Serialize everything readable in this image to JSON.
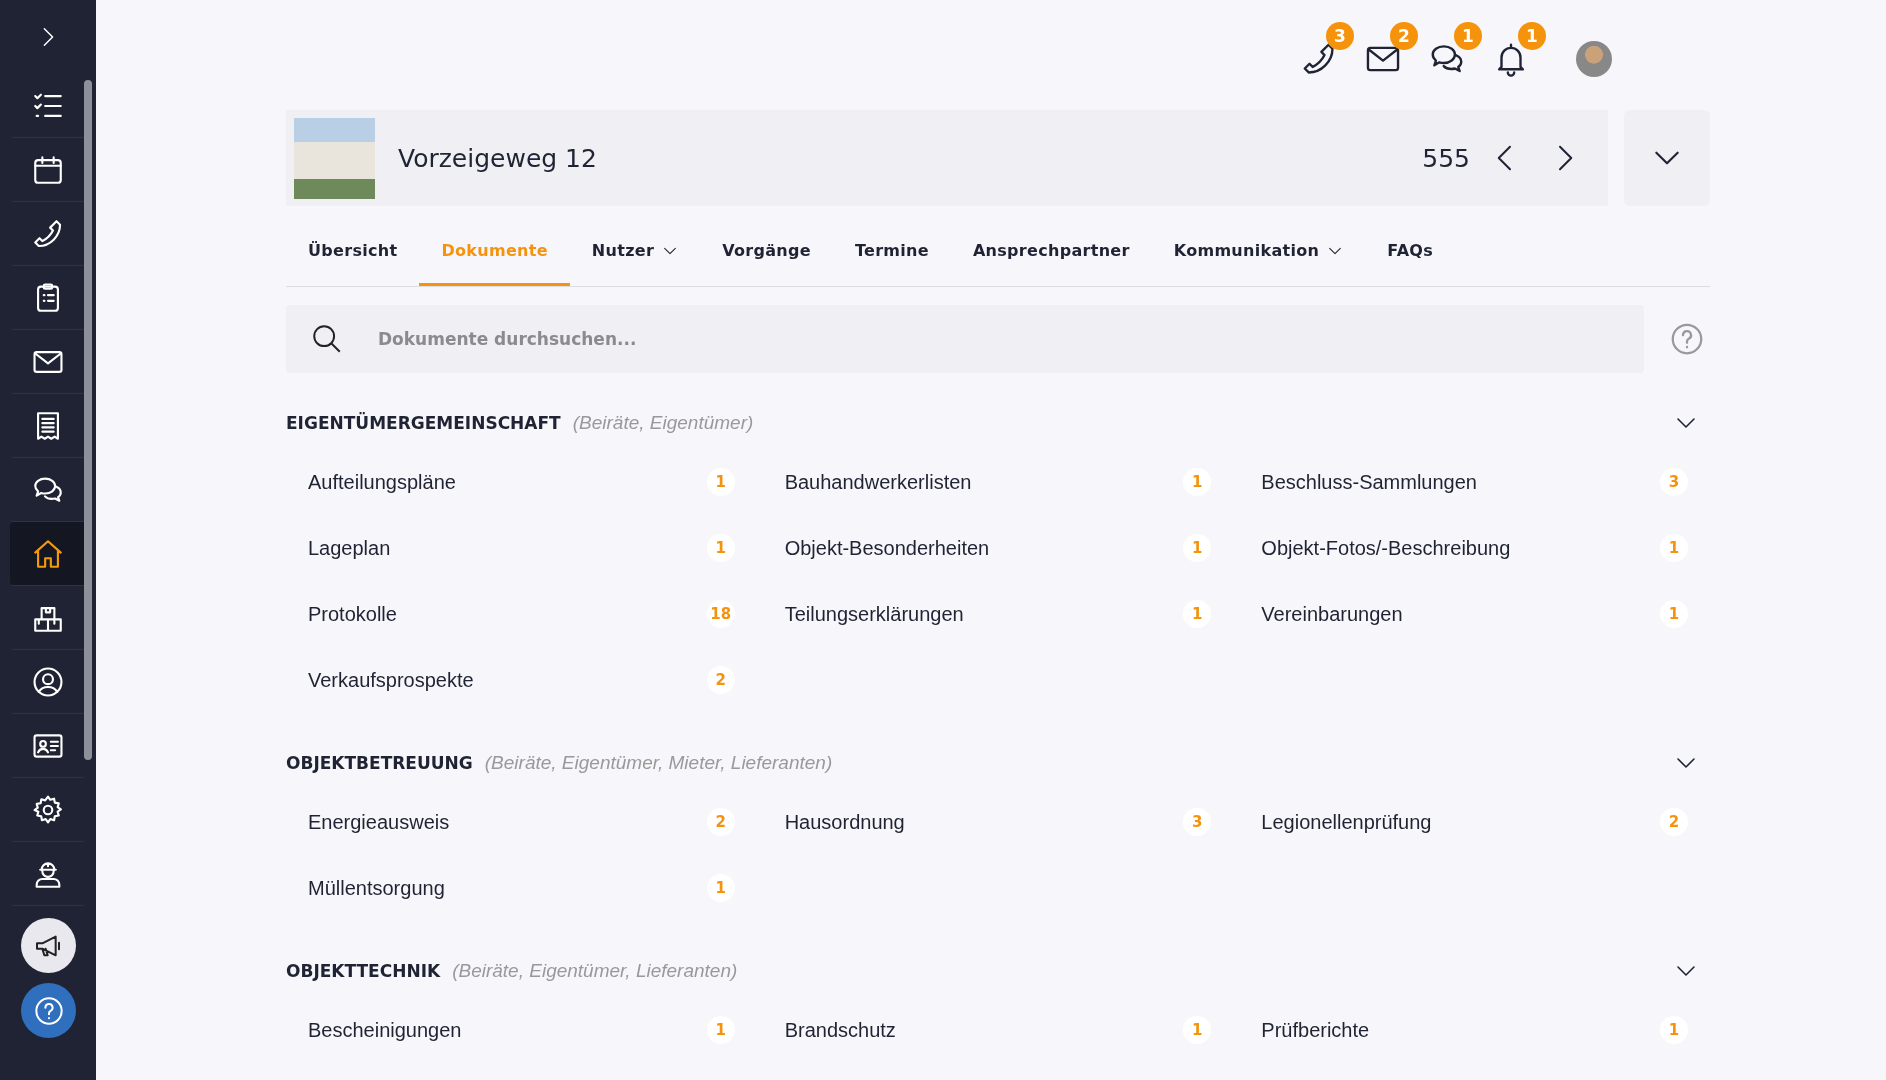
{
  "sidebar": {
    "items": [
      {
        "kind": "tasks",
        "selected": false
      },
      {
        "kind": "calendar",
        "selected": false
      },
      {
        "kind": "phone",
        "selected": false
      },
      {
        "kind": "clipboard",
        "selected": false
      },
      {
        "kind": "mail",
        "selected": false
      },
      {
        "kind": "receipt",
        "selected": false
      },
      {
        "kind": "chat",
        "selected": false
      },
      {
        "kind": "home",
        "selected": true
      },
      {
        "kind": "boxes",
        "selected": false
      },
      {
        "kind": "user",
        "selected": false
      },
      {
        "kind": "idcard",
        "selected": false
      },
      {
        "kind": "gear",
        "selected": false
      },
      {
        "kind": "worker",
        "selected": false
      }
    ],
    "buttons": [
      {
        "kind": "megaphone"
      },
      {
        "kind": "help"
      }
    ]
  },
  "top_bar": {
    "notifications": [
      {
        "kind": "phone",
        "count": "3"
      },
      {
        "kind": "mail",
        "count": "2"
      },
      {
        "kind": "chat",
        "count": "1"
      },
      {
        "kind": "bell",
        "count": "1"
      }
    ]
  },
  "property": {
    "title": "Vorzeigeweg 12",
    "number": "555"
  },
  "tabs": [
    {
      "label": "Übersicht",
      "selected": false,
      "dropdown": false
    },
    {
      "label": "Dokumente",
      "selected": true,
      "dropdown": false
    },
    {
      "label": "Nutzer",
      "selected": false,
      "dropdown": true
    },
    {
      "label": "Vorgänge",
      "selected": false,
      "dropdown": false
    },
    {
      "label": "Termine",
      "selected": false,
      "dropdown": false
    },
    {
      "label": "Ansprechpartner",
      "selected": false,
      "dropdown": false
    },
    {
      "label": "Kommunikation",
      "selected": false,
      "dropdown": true
    },
    {
      "label": "FAQs",
      "selected": false,
      "dropdown": false
    }
  ],
  "search": {
    "placeholder": "Dokumente durchsuchen..."
  },
  "sections": [
    {
      "title": "EIGENTÜMERGEMEINSCHAFT",
      "audience": "(Beiräte, Eigentümer)",
      "items": [
        {
          "name": "Aufteilungspläne",
          "count": "1"
        },
        {
          "name": "Bauhandwerkerlisten",
          "count": "1"
        },
        {
          "name": "Beschluss-Sammlungen",
          "count": "3"
        },
        {
          "name": "Lageplan",
          "count": "1"
        },
        {
          "name": "Objekt-Besonderheiten",
          "count": "1"
        },
        {
          "name": "Objekt-Fotos/-Beschreibung",
          "count": "1"
        },
        {
          "name": "Protokolle",
          "count": "18"
        },
        {
          "name": "Teilungserklärungen",
          "count": "1"
        },
        {
          "name": "Vereinbarungen",
          "count": "1"
        },
        {
          "name": "Verkaufsprospekte",
          "count": "2"
        }
      ]
    },
    {
      "title": "OBJEKTBETREUUNG",
      "audience": "(Beiräte, Eigentümer, Mieter, Lieferanten)",
      "items": [
        {
          "name": "Energieausweis",
          "count": "2"
        },
        {
          "name": "Hausordnung",
          "count": "3"
        },
        {
          "name": "Legionellenprüfung",
          "count": "2"
        },
        {
          "name": "Müllentsorgung",
          "count": "1"
        }
      ]
    },
    {
      "title": "OBJEKTTECHNIK",
      "audience": "(Beiräte, Eigentümer, Lieferanten)",
      "items": [
        {
          "name": "Bescheinigungen",
          "count": "1"
        },
        {
          "name": "Brandschutz",
          "count": "1"
        },
        {
          "name": "Prüfberichte",
          "count": "1"
        }
      ]
    }
  ]
}
